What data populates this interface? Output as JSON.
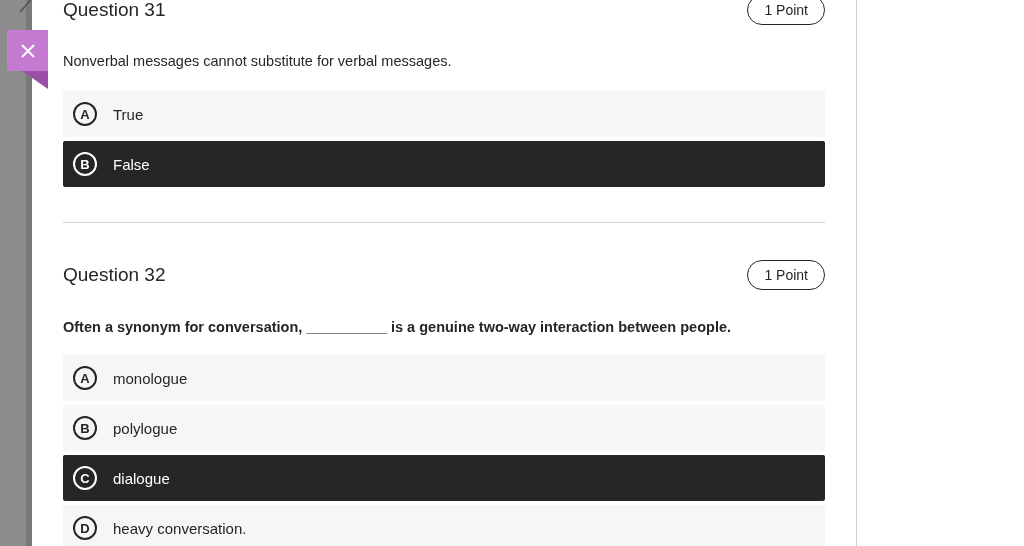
{
  "questions": [
    {
      "title": "Question 31",
      "points": "1 Point",
      "prompt": "Nonverbal messages cannot substitute for verbal messages.",
      "prompt_bold": false,
      "options": [
        {
          "letter": "A",
          "text": "True",
          "selected": false
        },
        {
          "letter": "B",
          "text": "False",
          "selected": true
        }
      ]
    },
    {
      "title": "Question 32",
      "points": "1 Point",
      "prompt": "Often a synonym for conversation, __________ is a genuine two-way interaction between people.",
      "prompt_bold": true,
      "options": [
        {
          "letter": "A",
          "text": "monologue",
          "selected": false
        },
        {
          "letter": "B",
          "text": "polylogue",
          "selected": false
        },
        {
          "letter": "C",
          "text": "dialogue",
          "selected": true
        },
        {
          "letter": "D",
          "text": "heavy conversation.",
          "selected": false
        }
      ]
    }
  ]
}
